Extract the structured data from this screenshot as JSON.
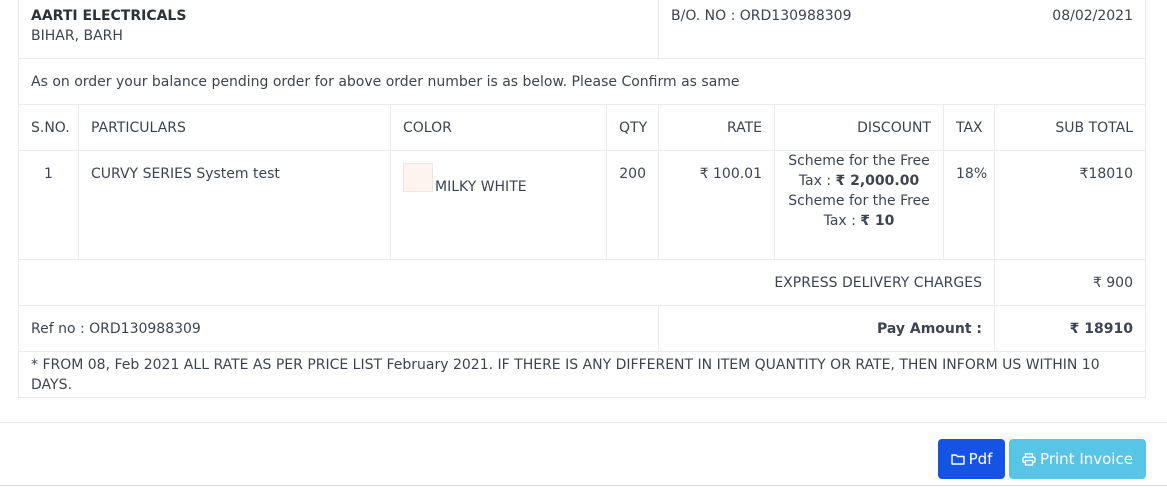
{
  "header": {
    "company_name": "AARTI ELECTRICALS",
    "company_location": "BIHAR, BARH",
    "bo_no": "B/O. NO : ORD130988309",
    "date": "08/02/2021"
  },
  "notice": "As on order your balance pending order for above order number is as below. Please Confirm as same",
  "columns": [
    "S.NO.",
    "PARTICULARS",
    "COLOR",
    "QTY",
    "RATE",
    "DISCOUNT",
    "TAX",
    "SUB TOTAL"
  ],
  "items": [
    {
      "sno": "1",
      "particulars": "CURVY SERIES System test",
      "color_name": "MILKY WHITE",
      "swatch_color": "#fdf3ef",
      "qty": "200",
      "rate": "₹ 100.01",
      "discounts": [
        {
          "scheme": "Scheme for the Free",
          "tax_label": "Tax : ",
          "amount": "₹ 2,000.00"
        },
        {
          "scheme": "Scheme for the Free",
          "tax_label": "Tax : ",
          "amount": "₹ 10"
        }
      ],
      "tax": "18%",
      "subtotal": "₹18010"
    }
  ],
  "express": {
    "label": "EXPRESS DELIVERY CHARGES",
    "value": "₹ 900"
  },
  "ref_no": "Ref no : ORD130988309",
  "pay": {
    "label": "Pay Amount :",
    "value": "₹ 18910"
  },
  "footer_note": "* FROM 08, Feb 2021 ALL RATE AS PER PRICE LIST February 2021. IF THERE IS ANY DIFFERENT IN ITEM QUANTITY OR RATE, THEN INFORM US WITHIN 10 DAYS.",
  "buttons": {
    "pdf": {
      "label": "Pdf",
      "icon": "folder-icon",
      "color": "#1553e3"
    },
    "print": {
      "label": "Print Invoice",
      "icon": "printer-icon",
      "color": "#58c4e6"
    }
  }
}
